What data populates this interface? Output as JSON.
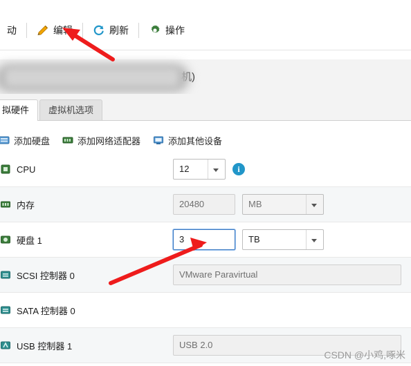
{
  "toolbar": {
    "partial_left_label": "动",
    "edit_label": "编辑",
    "refresh_label": "刷新",
    "action_label": "操作",
    "icons": {
      "edit": "pencil-icon",
      "refresh": "refresh-icon",
      "action": "gear-icon"
    }
  },
  "title_bar": {
    "visible_suffix": "机)"
  },
  "tabs": [
    {
      "label": "拟硬件",
      "active": true
    },
    {
      "label": "虚拟机选项",
      "active": false
    }
  ],
  "add_actions": [
    {
      "label": "添加硬盘",
      "icon": "hard-disk-icon"
    },
    {
      "label": "添加网络适配器",
      "icon": "network-adapter-icon"
    },
    {
      "label": "添加其他设备",
      "icon": "other-device-icon"
    }
  ],
  "devices": [
    {
      "name": "CPU",
      "icon_color": "#3b7d3b",
      "value": "12",
      "value_type": "select",
      "unit": "",
      "unit_type": "none",
      "info_badge": "i",
      "focused": false
    },
    {
      "name": "内存",
      "icon_color": "#3b7d3b",
      "value": "20480",
      "value_type": "input-readonly",
      "unit": "MB",
      "unit_type": "select-gray",
      "info_badge": "",
      "focused": false
    },
    {
      "name": "硬盘 1",
      "icon_color": "#3b7d3b",
      "value": "3",
      "value_type": "input",
      "unit": "TB",
      "unit_type": "select",
      "info_badge": "",
      "focused": true
    },
    {
      "name": "SCSI 控制器 0",
      "icon_color": "#2f8f8f",
      "value": "VMware Paravirtual",
      "value_type": "text-wide",
      "unit": "",
      "unit_type": "none",
      "info_badge": "",
      "focused": false
    },
    {
      "name": "SATA 控制器 0",
      "icon_color": "#2f8f8f",
      "value": "",
      "value_type": "none",
      "unit": "",
      "unit_type": "none",
      "info_badge": "",
      "focused": false
    },
    {
      "name": "USB 控制器 1",
      "icon_color": "#2f8f8f",
      "value": "USB 2.0",
      "value_type": "text-wide-gray",
      "unit": "",
      "unit_type": "none",
      "info_badge": "",
      "focused": false
    }
  ],
  "annotations": {
    "arrow_color": "#ee1c1c",
    "arrow_count": 2
  },
  "watermark": "CSDN @小鸡,啄米"
}
